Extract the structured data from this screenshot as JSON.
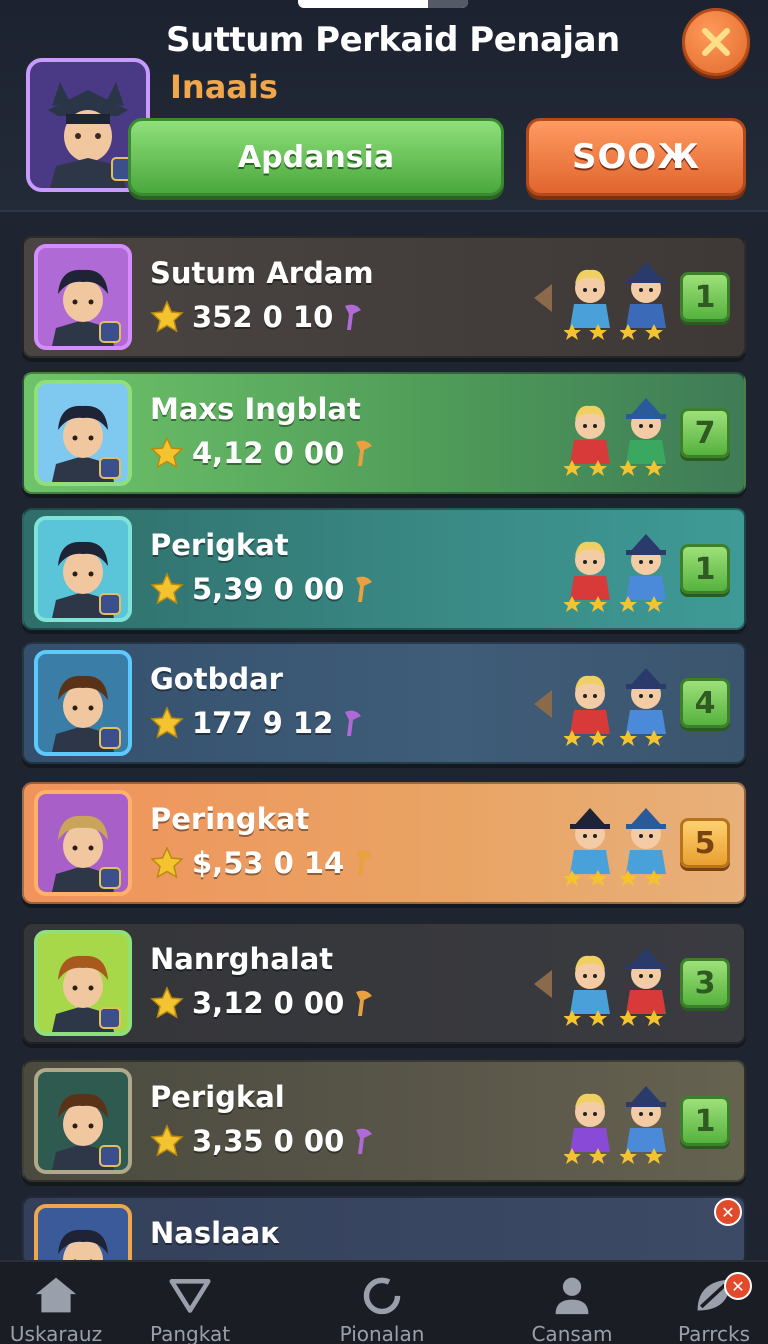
{
  "header": {
    "title": "Suttum Perkaid Penajan",
    "subtitle": "Inaais",
    "primary_button": "Apdansia",
    "secondary_button": "SOOЖ",
    "close_icon": "close-x-icon"
  },
  "leaderboard": [
    {
      "name": "Sutum Ardam",
      "score": "352 0 10",
      "rank": "1",
      "theme": "brown"
    },
    {
      "name": "Maxs Ingblat",
      "score": "4,12 0 00",
      "rank": "7",
      "theme": "green"
    },
    {
      "name": "Perigkat",
      "score": "5,39 0 00",
      "rank": "1",
      "theme": "teal"
    },
    {
      "name": "Gotbdar",
      "score": "177 9 12",
      "rank": "4",
      "theme": "blue"
    },
    {
      "name": "Peringkat",
      "score": "$,53 0 14",
      "rank": "5",
      "theme": "orange"
    },
    {
      "name": "Nanrghalat",
      "score": "3,12 0 00",
      "rank": "3",
      "theme": "dark"
    },
    {
      "name": "Perigkal",
      "score": "3,35 0 00",
      "rank": "1",
      "theme": "olive"
    },
    {
      "name": "Naslaaк",
      "score": "",
      "rank": "",
      "theme": "slate"
    }
  ],
  "bottom_nav": [
    {
      "label": "Uskarauz",
      "icon": "home-icon"
    },
    {
      "label": "Pangkat",
      "icon": "triangle-icon"
    },
    {
      "label": "Pionalan",
      "icon": "circle-icon"
    },
    {
      "label": "Cansam",
      "icon": "profile-icon"
    },
    {
      "label": "Parrcks",
      "icon": "leaf-icon"
    }
  ],
  "colors": {
    "accent_green": "#56b23e",
    "accent_orange": "#e0652e",
    "subtitle_orange": "#f0a64a",
    "background": "#1f2530"
  }
}
